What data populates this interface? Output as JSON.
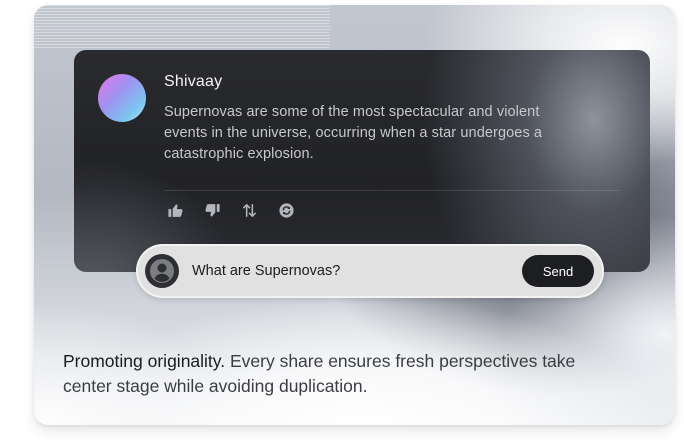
{
  "chat": {
    "author": "Shivaay",
    "message": "Supernovas are some of the most spectacular and violent events in the universe, occurring when a star undergoes a catastrophic explosion.",
    "actions": [
      {
        "name": "thumbs-up-icon"
      },
      {
        "name": "thumbs-down-icon"
      },
      {
        "name": "swap-vertical-icon"
      },
      {
        "name": "regenerate-icon"
      }
    ]
  },
  "composer": {
    "value": "What are Supernovas?",
    "send_label": "Send"
  },
  "caption": {
    "highlight": "Promoting originality.",
    "text": " Every share ensures fresh perspectives take center stage while avoiding duplication."
  },
  "colors": {
    "panel_dark": "#222327",
    "composer_bg": "#e1e1e1",
    "send_bg": "#1d1e21",
    "avatar_gradient": [
      "#e576e8",
      "#9f92f0",
      "#7cc4f0"
    ]
  }
}
